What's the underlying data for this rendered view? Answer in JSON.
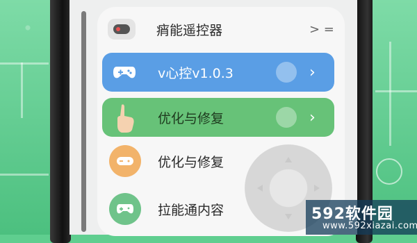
{
  "menu": {
    "items": [
      {
        "label": "痟能遥控器",
        "icon": "gamepad-icon"
      },
      {
        "label": "v心控v1.0.3",
        "icon": "gamepad-icon"
      },
      {
        "label": "优化与修复",
        "icon": "hand-pointer-icon"
      },
      {
        "label": "优化与修复",
        "icon": "gamepad-icon"
      },
      {
        "label": "拉能通内容",
        "icon": "gamepad-icon"
      }
    ],
    "top_right_indicator": "> ="
  },
  "watermark": {
    "title": "592软件园",
    "url": "www.592xiazai.com"
  },
  "colors": {
    "background_green": "#5fce8f",
    "row_blue": "#5a9ee5",
    "row_green": "#67c278",
    "icon_orange": "#f2b36a",
    "icon_green": "#6fc38a"
  }
}
